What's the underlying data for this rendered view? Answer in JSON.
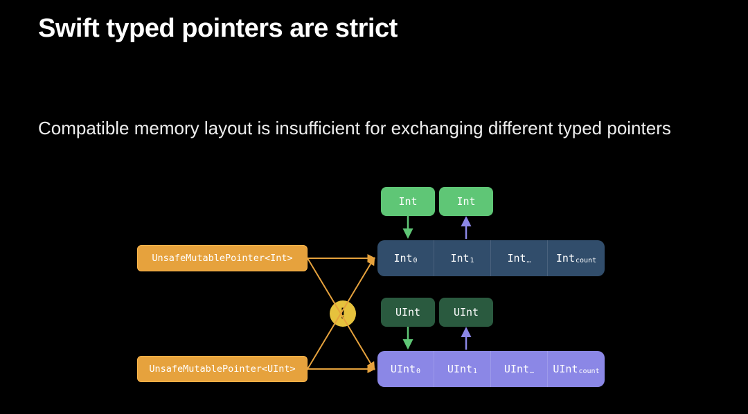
{
  "title": "Swift typed pointers are strict",
  "subtitle": "Compatible memory layout is insufficient for exchanging different typed pointers",
  "pointers": {
    "int_pointer": "UnsafeMutablePointer<Int>",
    "uint_pointer": "UnsafeMutablePointer<UInt>"
  },
  "warning_symbol": "!",
  "floating": {
    "int_a": "Int",
    "int_b": "Int",
    "uint_a": "UInt",
    "uint_b": "UInt"
  },
  "int_buffer": {
    "cell0_base": "Int",
    "cell0_sub": "0",
    "cell1_base": "Int",
    "cell1_sub": "1",
    "cell2_base": "Int",
    "cell2_sub": "…",
    "cell3_base": "Int",
    "cell3_sub": "count"
  },
  "uint_buffer": {
    "cell0_base": "UInt",
    "cell0_sub": "0",
    "cell1_base": "UInt",
    "cell1_sub": "1",
    "cell2_base": "UInt",
    "cell2_sub": "…",
    "cell3_base": "UInt",
    "cell3_sub": "count"
  },
  "colors": {
    "pointer_fill": "#e6a23d",
    "warning_fill": "#e6c23d",
    "int_buffer_fill": "#314d6b",
    "uint_buffer_fill": "#8b87e6",
    "float_green": "#5fc676",
    "float_dark_green": "#2a5a3f",
    "arrow_orange": "#e6a23d",
    "arrow_green": "#5fc676",
    "arrow_purple": "#8b87e6"
  }
}
